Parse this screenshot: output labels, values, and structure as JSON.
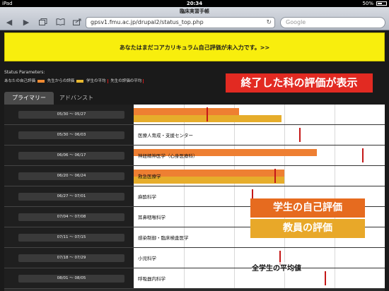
{
  "status": {
    "carrier": "iPad",
    "time": "20:34",
    "battery": "50%"
  },
  "browser": {
    "page_title": "臨床実習手帳",
    "url": "gpsv1.fmu.ac.jp/drupal2/status_top.php",
    "search_placeholder": "Google",
    "back_icon": "◀",
    "forward_icon": "▶"
  },
  "notice": "あなたはまだコアカリキュラム自己評価が未入力です。>>",
  "legend": {
    "title": "Status Parameters:",
    "self": "あなたの自己評価",
    "teacher": "先生からの評価",
    "student_avg": "学生の平均",
    "teacher_avg": "先生の評価の平均"
  },
  "annotations": {
    "top": "終了した科の評価が表示",
    "student": "学生の自己評価",
    "teacher": "教員の評価",
    "avg": "全学生の平均値"
  },
  "tabs": {
    "primary": "プライマリー",
    "advanced": "アドバンスト"
  },
  "rows": [
    {
      "period": "05/30 ～ 05/27",
      "subject": "",
      "self": 0.42,
      "teacher": 0.59,
      "avg": 0.29
    },
    {
      "period": "05/30 ～ 06/03",
      "subject": "医療人育成・支援センター",
      "self": 0,
      "teacher": 0,
      "avg": 0.66
    },
    {
      "period": "06/06 ～ 06/17",
      "subject": "神経精神医学（心身医療科）",
      "self": 0.73,
      "teacher": 0,
      "avg": 0.91
    },
    {
      "period": "06/20 ～ 06/24",
      "subject": "救急医療学",
      "self": 0.6,
      "teacher": 0.6,
      "avg": 0.56
    },
    {
      "period": "06/27 ～ 07/01",
      "subject": "麻酔科学",
      "self": 0,
      "teacher": 0,
      "avg": 0.47
    },
    {
      "period": "07/04 ～ 07/08",
      "subject": "耳鼻咽喉科学",
      "self": 0,
      "teacher": 0,
      "avg": 0
    },
    {
      "period": "07/11 ～ 07/15",
      "subject": "感染制御・臨床検査医学",
      "self": 0,
      "teacher": 0,
      "avg": 0
    },
    {
      "period": "07/18 ～ 07/29",
      "subject": "小児科学",
      "self": 0,
      "teacher": 0,
      "avg": 0.58
    },
    {
      "period": "08/01 ～ 08/05",
      "subject": "呼吸器内科学",
      "self": 0,
      "teacher": 0,
      "avg": 0.76
    }
  ]
}
